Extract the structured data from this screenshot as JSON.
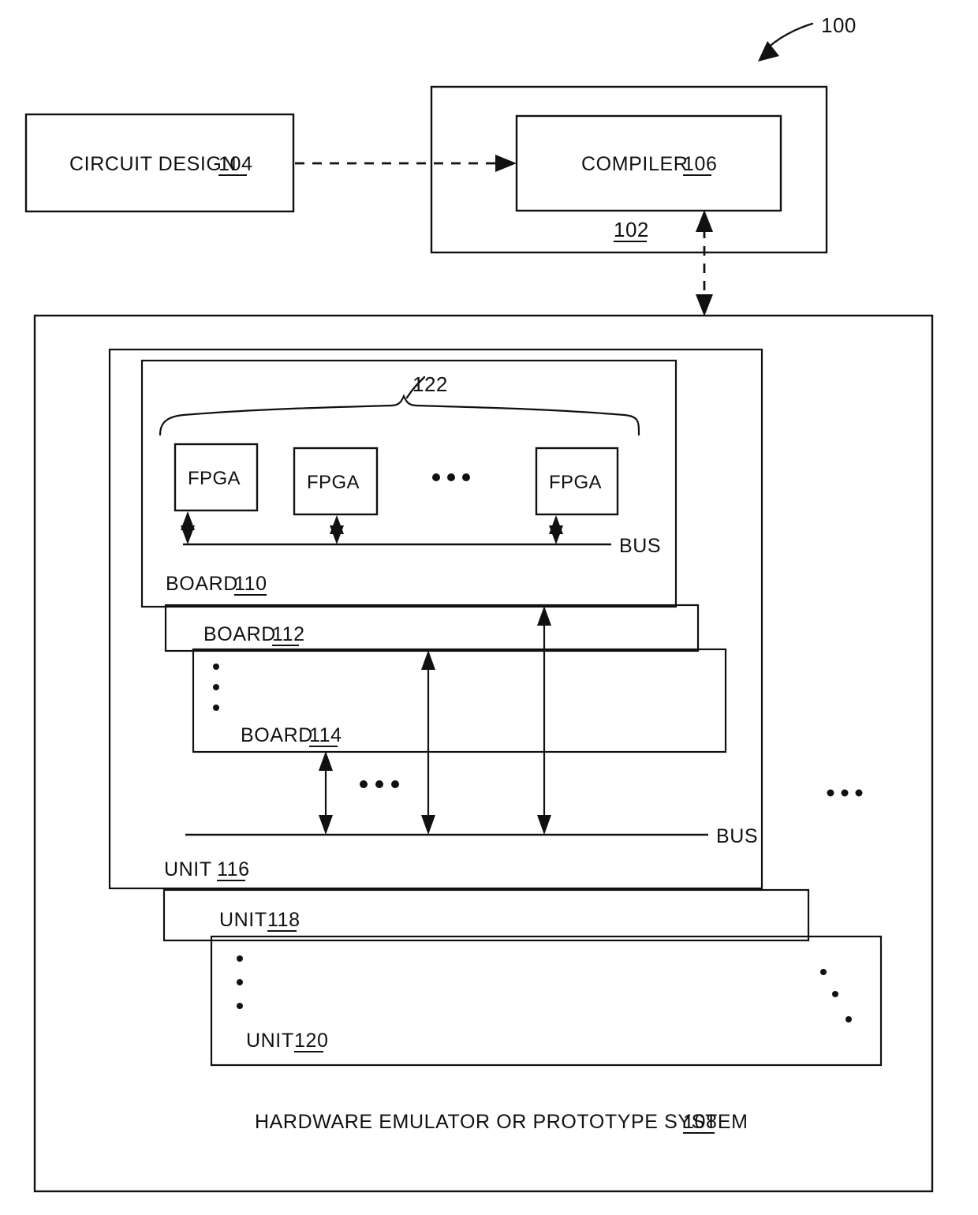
{
  "figure": {
    "title": "HARDWARE EMULATOR OR PROTOTYPE SYSTEM",
    "figure_reference": "100"
  },
  "blocks": {
    "circuit_design": {
      "label": "CIRCUIT DESIGN",
      "ref": "104"
    },
    "host_system": {
      "ref": "102"
    },
    "compiler": {
      "label": "COMPILER",
      "ref": "106"
    },
    "emulator_system": {
      "label": "HARDWARE EMULATOR OR PROTOTYPE SYSTEM",
      "ref": "108"
    },
    "board_110": {
      "label": "BOARD",
      "ref": "110"
    },
    "board_112": {
      "label": "BOARD",
      "ref": "112"
    },
    "board_114": {
      "label": "BOARD",
      "ref": "114"
    },
    "unit_116": {
      "label": "UNIT",
      "ref": "116"
    },
    "unit_118": {
      "label": "UNIT",
      "ref": "118"
    },
    "unit_120": {
      "label": "UNIT",
      "ref": "120"
    },
    "fpga_group": {
      "ref": "122"
    }
  },
  "fpgas": [
    {
      "label": "FPGA"
    },
    {
      "label": "FPGA"
    },
    {
      "label": "FPGA"
    }
  ],
  "buses": [
    {
      "label": "BUS",
      "location": "board-110"
    },
    {
      "label": "BUS",
      "location": "unit-116"
    }
  ],
  "ellipses": {
    "fpga_row": "· · ·",
    "board_column": "⋮",
    "board_row": "· · ·",
    "unit_column": "⋮",
    "unit_stack": "· · ·",
    "unit_diagonal": "⋰"
  },
  "colors": {
    "ink": "#111111",
    "paper": "#ffffff"
  }
}
